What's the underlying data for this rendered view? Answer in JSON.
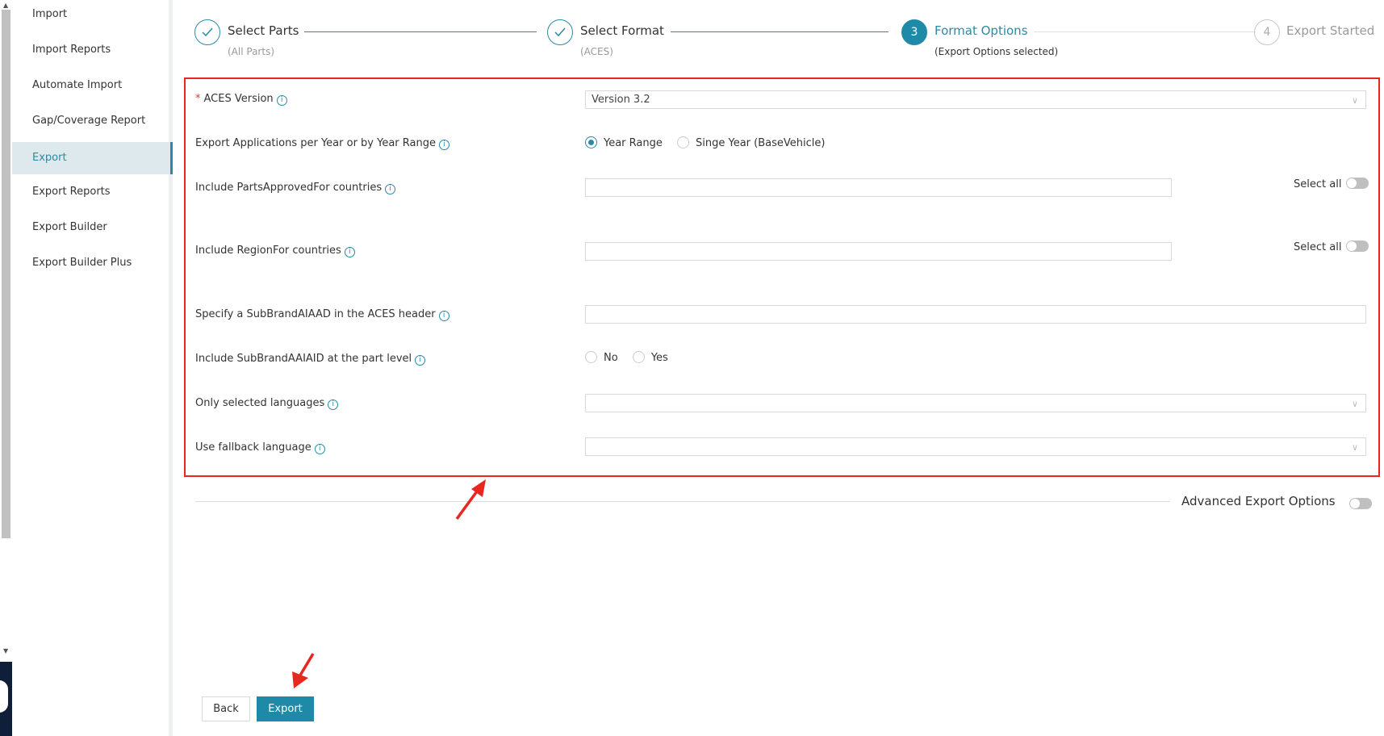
{
  "sidebar": {
    "items": [
      {
        "label": "Import"
      },
      {
        "label": "Import Reports"
      },
      {
        "label": "Automate Import"
      },
      {
        "label": "Gap/Coverage Report"
      },
      {
        "label": "Export"
      },
      {
        "label": "Export Reports"
      },
      {
        "label": "Export Builder"
      },
      {
        "label": "Export Builder Plus"
      }
    ],
    "active_item": "Export"
  },
  "stepper": {
    "steps": [
      {
        "number": "1",
        "title": "Select Parts",
        "subtitle": "(All Parts)",
        "state": "done"
      },
      {
        "number": "2",
        "title": "Select Format",
        "subtitle": "(ACES)",
        "state": "done"
      },
      {
        "number": "3",
        "title": "Format Options",
        "subtitle": "(Export Options selected)",
        "state": "active"
      },
      {
        "number": "4",
        "title": "Export Started",
        "subtitle": "",
        "state": "pending"
      }
    ]
  },
  "form": {
    "aces_version": {
      "label": "ACES Version",
      "required_mark": "*",
      "value": "Version 3.2"
    },
    "year_mode": {
      "label": "Export Applications per Year or by Year Range",
      "options": [
        "Year Range",
        "Singe Year (BaseVehicle)"
      ],
      "selected": "Year Range"
    },
    "parts_approved_for": {
      "label": "Include PartsApprovedFor countries",
      "value": "",
      "select_all_label": "Select all",
      "select_all_on": false
    },
    "region_for": {
      "label": "Include RegionFor countries",
      "value": "",
      "select_all_label": "Select all",
      "select_all_on": false
    },
    "sub_brand_header": {
      "label": "Specify a SubBrandAIAAD in the ACES header",
      "value": ""
    },
    "sub_brand_part": {
      "label": "Include SubBrandAAIAID at the part level",
      "options": [
        "No",
        "Yes"
      ],
      "selected": ""
    },
    "languages": {
      "label": "Only selected languages",
      "value": ""
    },
    "fallback_language": {
      "label": "Use fallback language",
      "value": ""
    }
  },
  "advanced": {
    "label": "Advanced Export Options",
    "enabled": false
  },
  "buttons": {
    "back": "Back",
    "export": "Export"
  },
  "icons": {
    "info": "info-icon",
    "check": "check-icon",
    "chevron": "chevron-down-icon"
  },
  "colors": {
    "accent": "#1f8aa8",
    "highlight": "#e8271e",
    "active_bg": "#dde9ec"
  }
}
